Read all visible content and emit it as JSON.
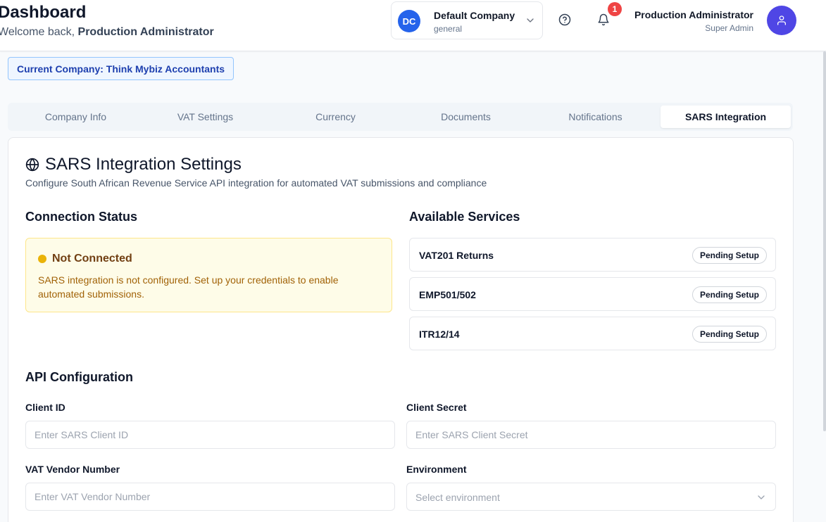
{
  "header": {
    "title": "Dashboard",
    "welcome_prefix": "Welcome back,",
    "welcome_user": "Production Administrator"
  },
  "company_switcher": {
    "initials": "DC",
    "name": "Default Company",
    "subtitle": "general",
    "chevron_icon": "chevron-down-icon"
  },
  "notifications": {
    "count": "1",
    "icon": "bell-icon"
  },
  "help": {
    "icon": "help-circle-icon"
  },
  "user": {
    "name": "Production Administrator",
    "role": "Super Admin",
    "icon": "user-icon"
  },
  "current_company": "Current Company: Think Mybiz Accountants",
  "tabs": [
    {
      "label": "Company Info",
      "active": false
    },
    {
      "label": "VAT Settings",
      "active": false
    },
    {
      "label": "Currency",
      "active": false
    },
    {
      "label": "Documents",
      "active": false
    },
    {
      "label": "Notifications",
      "active": false
    },
    {
      "label": "SARS Integration",
      "active": true
    }
  ],
  "card": {
    "icon": "globe-icon",
    "title": "SARS Integration Settings",
    "description": "Configure South African Revenue Service API integration for automated VAT submissions and compliance"
  },
  "connection_status": {
    "heading": "Connection Status",
    "status": "Not Connected",
    "message": "SARS integration is not configured. Set up your credentials to enable automated submissions.",
    "status_color": "#eab308"
  },
  "available_services": {
    "heading": "Available Services",
    "items": [
      {
        "name": "VAT201 Returns",
        "badge": "Pending Setup"
      },
      {
        "name": "EMP501/502",
        "badge": "Pending Setup"
      },
      {
        "name": "ITR12/14",
        "badge": "Pending Setup"
      }
    ]
  },
  "api_configuration": {
    "heading": "API Configuration",
    "client_id": {
      "label": "Client ID",
      "placeholder": "Enter SARS Client ID",
      "value": ""
    },
    "client_secret": {
      "label": "Client Secret",
      "placeholder": "Enter SARS Client Secret",
      "value": ""
    },
    "vat_vendor_number": {
      "label": "VAT Vendor Number",
      "placeholder": "Enter VAT Vendor Number",
      "value": ""
    },
    "environment": {
      "label": "Environment",
      "placeholder": "Select environment",
      "value": ""
    }
  },
  "colors": {
    "primary": "#2563eb",
    "avatar": "#4f46e5",
    "badge": "#ef4444",
    "warning_bg": "#fefce8",
    "warning_border": "#fde68a"
  }
}
